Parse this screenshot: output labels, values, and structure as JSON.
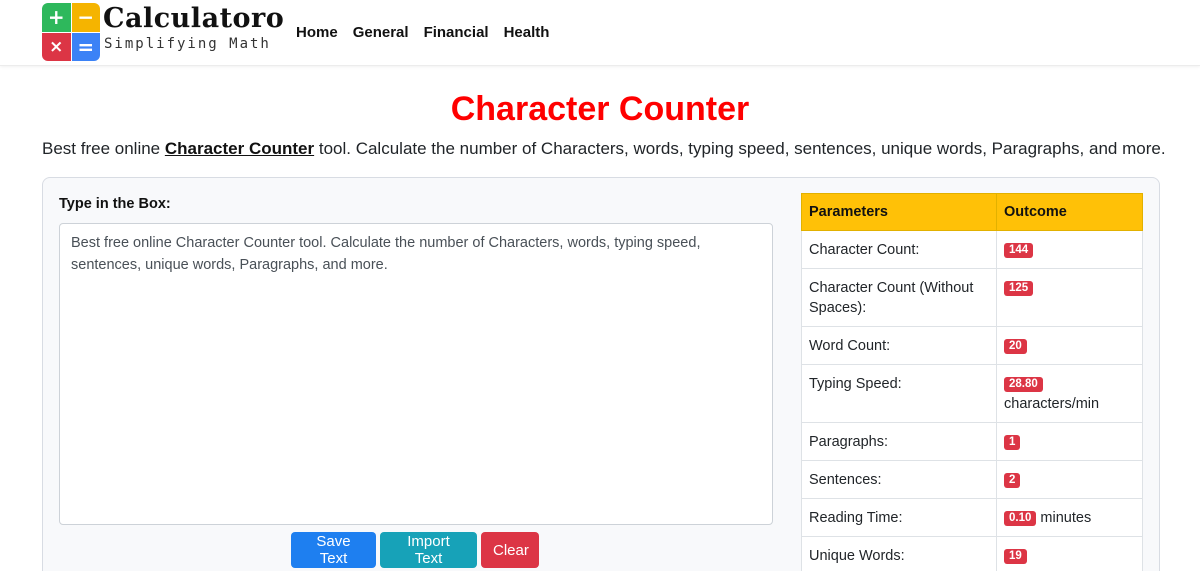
{
  "header": {
    "brand_name": "Calculatoro",
    "brand_tagline": "Simplifying Math",
    "logo_glyphs": {
      "plus": "+",
      "minus": "−",
      "times": "×",
      "equals": "="
    },
    "nav": [
      "Home",
      "General",
      "Financial",
      "Health"
    ]
  },
  "page": {
    "title": "Character Counter",
    "intro_prefix": "Best free online ",
    "intro_link": "Character Counter",
    "intro_suffix": " tool. Calculate the number of Characters, words, typing speed, sentences, unique words, Paragraphs, and more."
  },
  "editor": {
    "label": "Type in the Box:",
    "text": "Best free online Character Counter tool. Calculate the number of Characters, words, typing speed, sentences, unique words, Paragraphs, and more.",
    "buttons": {
      "save": "Save Text",
      "import": "Import Text",
      "clear": "Clear"
    }
  },
  "results": {
    "headers": [
      "Parameters",
      "Outcome"
    ],
    "rows": [
      {
        "param": "Character Count:",
        "value": "144",
        "unit": ""
      },
      {
        "param": "Character Count (Without Spaces):",
        "value": "125",
        "unit": ""
      },
      {
        "param": "Word Count:",
        "value": "20",
        "unit": ""
      },
      {
        "param": "Typing Speed:",
        "value": "28.80",
        "unit": "characters/min"
      },
      {
        "param": "Paragraphs:",
        "value": "1",
        "unit": ""
      },
      {
        "param": "Sentences:",
        "value": "2",
        "unit": ""
      },
      {
        "param": "Reading Time:",
        "value": "0.10",
        "unit": "minutes"
      },
      {
        "param": "Unique Words:",
        "value": "19",
        "unit": ""
      }
    ]
  },
  "colors": {
    "title": "#ff0000",
    "header_bg": "#ffc107",
    "badge": "#dc3545",
    "save": "#1e7ff0",
    "import": "#17a2b8",
    "clear": "#dc3545"
  }
}
